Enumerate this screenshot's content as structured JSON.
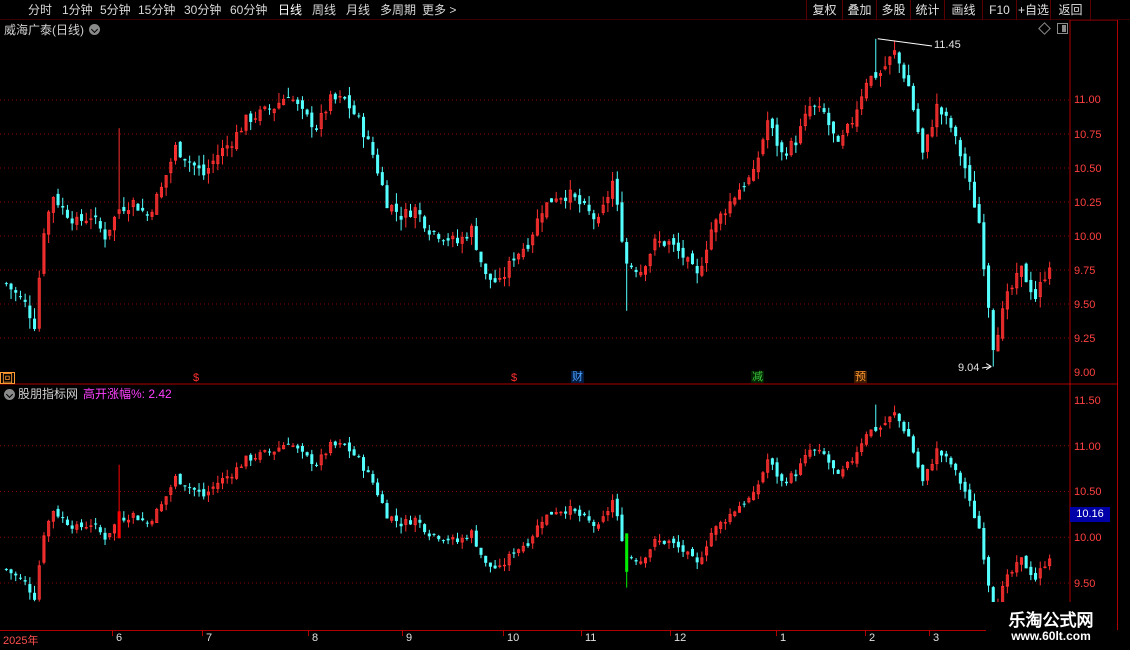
{
  "toolbar": {
    "periods": [
      "分时",
      "1分钟",
      "5分钟",
      "15分钟",
      "30分钟",
      "60分钟",
      "日线",
      "周线",
      "月线",
      "多周期",
      "更多 >"
    ],
    "active_period": "日线",
    "buttons": [
      "复权",
      "叠加",
      "多股",
      "统计",
      "画线",
      "F10",
      "+自选",
      "返回"
    ]
  },
  "main_panel": {
    "title": "威海广泰(日线)",
    "price_labels": [
      "11.00",
      "10.75",
      "10.50",
      "10.25",
      "10.00",
      "9.75",
      "9.50",
      "9.25",
      "9.00"
    ],
    "high_marker": "11.45",
    "low_marker": "9.04",
    "event_tags": [
      {
        "label": "回",
        "color": "#ff9a30"
      },
      {
        "label": "$",
        "color": "#ff3030"
      },
      {
        "label": "$",
        "color": "#ff3030"
      },
      {
        "label": "财",
        "color": "#4aa0ff"
      },
      {
        "label": "减",
        "color": "#3cc83c"
      },
      {
        "label": "预",
        "color": "#ff9a30"
      }
    ]
  },
  "indicator_panel": {
    "title": "股朋指标网",
    "indicator_label": "高开涨幅%: 2.42",
    "price_labels": [
      "11.50",
      "11.00",
      "10.50",
      "10.16",
      "10.00",
      "9.50"
    ],
    "current_price": "10.16"
  },
  "date_axis": {
    "labels": [
      "2025年",
      "6",
      "7",
      "8",
      "9",
      "10",
      "11",
      "12",
      "1",
      "2",
      "3"
    ]
  },
  "watermark": {
    "title": "乐淘公式网",
    "url": "www.60lt.com"
  },
  "colors": {
    "up": "#ff3030",
    "down": "#54ffff",
    "grid": "#8a0000",
    "frame": "#b00000",
    "indicator_label": "#ff40ff",
    "highlight_up": "#ff0000",
    "highlight_down": "#00ee00"
  },
  "chart_data": {
    "type": "candlestick",
    "title": "威海广泰(日线)",
    "ylim": [
      9.0,
      11.5
    ],
    "y_ticks": [
      9.0,
      9.25,
      9.5,
      9.75,
      10.0,
      10.25,
      10.5,
      10.75,
      11.0
    ],
    "x_month_labels": [
      "2025年",
      "6",
      "7",
      "8",
      "9",
      "10",
      "11",
      "12",
      "1",
      "2",
      "3"
    ],
    "high": 11.45,
    "low": 9.04,
    "close_points": [
      [
        0,
        9.65
      ],
      [
        4,
        9.5
      ],
      [
        6,
        9.35
      ],
      [
        8,
        10.05
      ],
      [
        10,
        10.3
      ],
      [
        12,
        10.2
      ],
      [
        15,
        10.1
      ],
      [
        18,
        10.15
      ],
      [
        21,
        10.0
      ],
      [
        24,
        10.2
      ],
      [
        27,
        10.25
      ],
      [
        30,
        10.15
      ],
      [
        33,
        10.35
      ],
      [
        36,
        10.65
      ],
      [
        39,
        10.55
      ],
      [
        42,
        10.45
      ],
      [
        45,
        10.6
      ],
      [
        48,
        10.7
      ],
      [
        51,
        10.85
      ],
      [
        54,
        10.9
      ],
      [
        57,
        10.95
      ],
      [
        60,
        11.05
      ],
      [
        63,
        10.9
      ],
      [
        66,
        10.8
      ],
      [
        69,
        11.0
      ],
      [
        72,
        11.0
      ],
      [
        75,
        10.85
      ],
      [
        78,
        10.6
      ],
      [
        81,
        10.25
      ],
      [
        84,
        10.15
      ],
      [
        87,
        10.2
      ],
      [
        90,
        10.05
      ],
      [
        93,
        10.0
      ],
      [
        96,
        9.95
      ],
      [
        99,
        10.05
      ],
      [
        102,
        9.7
      ],
      [
        105,
        9.65
      ],
      [
        108,
        9.85
      ],
      [
        111,
        9.95
      ],
      [
        114,
        10.2
      ],
      [
        117,
        10.3
      ],
      [
        120,
        10.3
      ],
      [
        123,
        10.2
      ],
      [
        126,
        10.1
      ],
      [
        129,
        10.4
      ],
      [
        132,
        9.8
      ],
      [
        135,
        9.75
      ],
      [
        138,
        9.95
      ],
      [
        141,
        9.95
      ],
      [
        144,
        9.85
      ],
      [
        147,
        9.7
      ],
      [
        150,
        10.05
      ],
      [
        153,
        10.2
      ],
      [
        156,
        10.35
      ],
      [
        159,
        10.45
      ],
      [
        162,
        10.85
      ],
      [
        165,
        10.6
      ],
      [
        168,
        10.7
      ],
      [
        171,
        10.95
      ],
      [
        174,
        10.9
      ],
      [
        177,
        10.65
      ],
      [
        180,
        10.85
      ],
      [
        183,
        11.15
      ],
      [
        186,
        11.2
      ],
      [
        189,
        11.35
      ],
      [
        192,
        11.1
      ],
      [
        195,
        10.6
      ],
      [
        198,
        10.95
      ],
      [
        201,
        10.8
      ],
      [
        204,
        10.5
      ],
      [
        207,
        10.1
      ],
      [
        210,
        9.2
      ],
      [
        213,
        9.55
      ],
      [
        216,
        9.75
      ],
      [
        219,
        9.55
      ],
      [
        222,
        9.8
      ]
    ]
  }
}
